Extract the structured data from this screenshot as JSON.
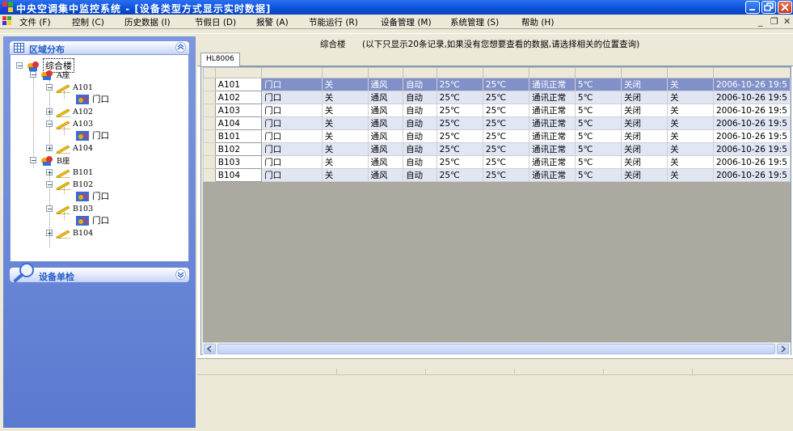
{
  "window": {
    "title": "中央空调集中监控系统 - [设备类型方式显示实时数据]"
  },
  "menu": {
    "items": [
      "文件 (F)",
      "控制 (C)",
      "历史数据 (I)",
      "节假日 (D)",
      "报警 (A)",
      "节能运行 (R)",
      "设备管理 (M)",
      "系统管理 (S)",
      "帮助 (H)"
    ],
    "mdi_min": "_",
    "mdi_restore": "❐",
    "mdi_close": "✕"
  },
  "left_panel": {
    "area_title": "区域分布",
    "device_title": "设备单检",
    "tree": {
      "root": "综合楼",
      "building_a": "A座",
      "building_b": "B座",
      "door": "门口",
      "rooms_a": [
        "A101",
        "A102",
        "A103",
        "A104"
      ],
      "rooms_b": [
        "B101",
        "B102",
        "B103",
        "B104"
      ]
    }
  },
  "main": {
    "building": "综合楼",
    "notice": "(以下只显示20条记录,如果没有您想要查看的数据,请选择相关的位置查询)",
    "tab": "HL8006",
    "rows": [
      [
        "A101",
        "门口",
        "关",
        "通风",
        "自动",
        "25℃",
        "25℃",
        "通讯正常",
        "5℃",
        "关闭",
        "关",
        "2006-10-26 19:5"
      ],
      [
        "A102",
        "门口",
        "关",
        "通风",
        "自动",
        "25℃",
        "25℃",
        "通讯正常",
        "5℃",
        "关闭",
        "关",
        "2006-10-26 19:5"
      ],
      [
        "A103",
        "门口",
        "关",
        "通风",
        "自动",
        "25℃",
        "25℃",
        "通讯正常",
        "5℃",
        "关闭",
        "关",
        "2006-10-26 19:5"
      ],
      [
        "A104",
        "门口",
        "关",
        "通风",
        "自动",
        "25℃",
        "25℃",
        "通讯正常",
        "5℃",
        "关闭",
        "关",
        "2006-10-26 19:5"
      ],
      [
        "B101",
        "门口",
        "关",
        "通风",
        "自动",
        "25℃",
        "25℃",
        "通讯正常",
        "5℃",
        "关闭",
        "关",
        "2006-10-26 19:5"
      ],
      [
        "B102",
        "门口",
        "关",
        "通风",
        "自动",
        "25℃",
        "25℃",
        "通讯正常",
        "5℃",
        "关闭",
        "关",
        "2006-10-26 19:5"
      ],
      [
        "B103",
        "门口",
        "关",
        "通风",
        "自动",
        "25℃",
        "25℃",
        "通讯正常",
        "5℃",
        "关闭",
        "关",
        "2006-10-26 19:5"
      ],
      [
        "B104",
        "门口",
        "关",
        "通风",
        "自动",
        "25℃",
        "25℃",
        "通讯正常",
        "5℃",
        "关闭",
        "关",
        "2006-10-26 19:5"
      ]
    ],
    "selected_row": 0
  }
}
